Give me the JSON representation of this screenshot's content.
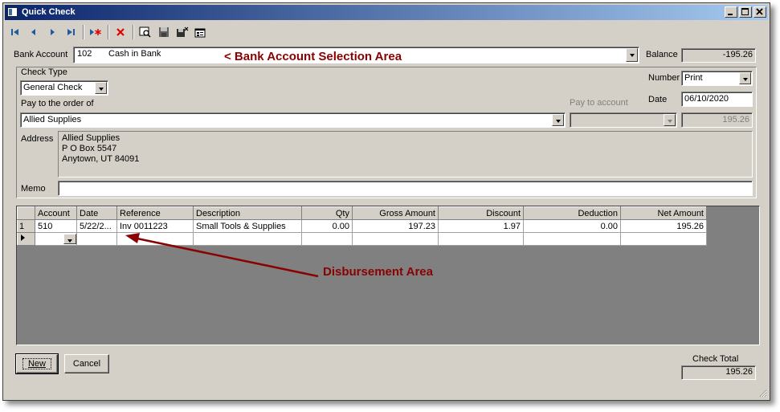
{
  "window": {
    "title": "Quick Check"
  },
  "toolbar": {
    "icons": [
      "first-record-icon",
      "previous-record-icon",
      "next-record-icon",
      "last-record-icon",
      "new-record-icon",
      "delete-icon",
      "find-icon",
      "save-icon",
      "save-close-icon",
      "properties-icon"
    ]
  },
  "bank_account": {
    "label": "Bank Account",
    "number": "102",
    "name": "Cash in Bank",
    "balance_label": "Balance",
    "balance": "-195.26"
  },
  "check": {
    "type_label": "Check Type",
    "type": "General Check",
    "number_label": "Number",
    "number": "Print",
    "date_label": "Date",
    "date": "06/10/2020",
    "pay_to_label": "Pay to the order of",
    "pay_to": "Allied Supplies",
    "pay_to_account_label": "Pay to account",
    "pay_to_account": "",
    "amount": "195.26",
    "address_label": "Address",
    "address_lines": [
      "Allied Supplies",
      "P O Box 5547",
      "Anytown, UT 84091"
    ],
    "memo_label": "Memo",
    "memo": ""
  },
  "grid": {
    "columns": [
      "Account",
      "Date",
      "Reference",
      "Description",
      "Qty",
      "Gross Amount",
      "Discount",
      "Deduction",
      "Net Amount"
    ],
    "rows": [
      {
        "num": "1",
        "cells": [
          "510",
          "5/22/2...",
          "Inv 0011223",
          "Small Tools & Supplies",
          "0.00",
          "197.23",
          "1.97",
          "0.00",
          "195.26"
        ]
      }
    ]
  },
  "annotations": {
    "bank_area": "<  Bank Account Selection Area",
    "disbursement_area": "Disbursement Area"
  },
  "buttons": {
    "new": "New",
    "cancel": "Cancel"
  },
  "totals": {
    "check_total_label": "Check Total",
    "check_total": "195.26"
  },
  "colors": {
    "title_start": "#0a246a",
    "title_end": "#a6caf0",
    "annotation": "#8b0000",
    "window_bg": "#d4d0c8"
  }
}
